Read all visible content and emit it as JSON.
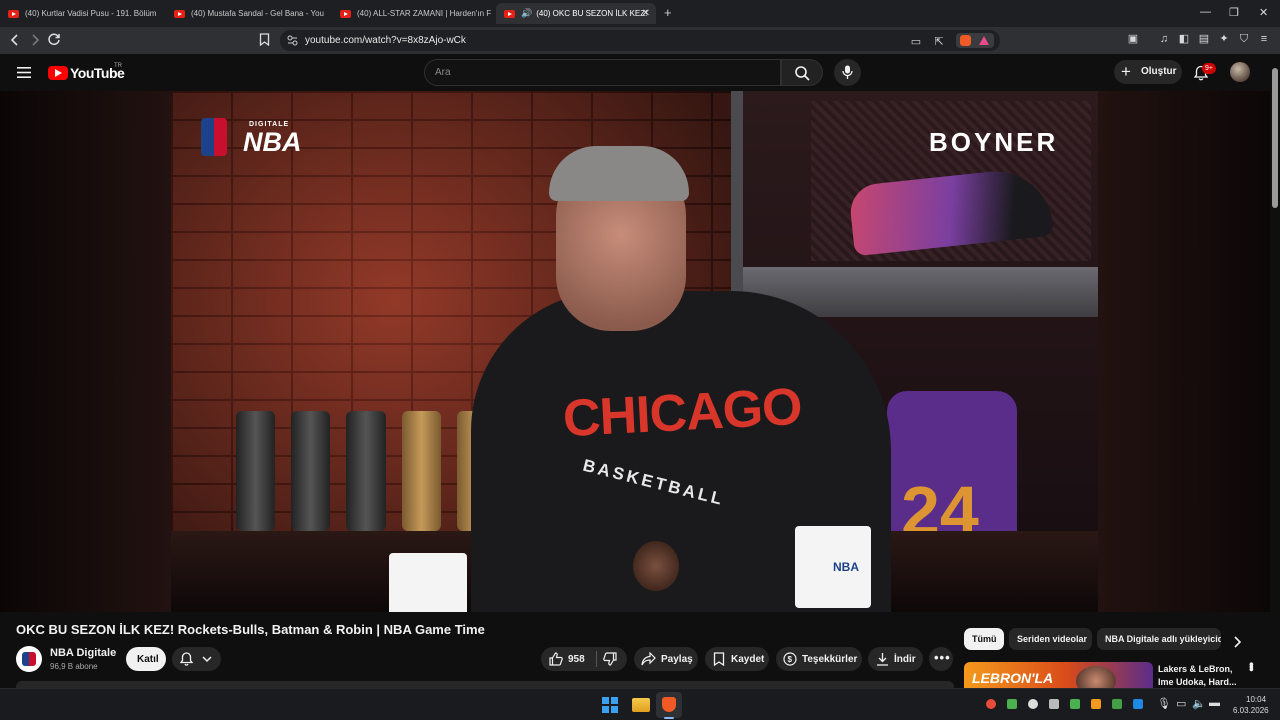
{
  "browser": {
    "tabs": [
      {
        "title": "(40) Kurtlar Vadisi Pusu - 191. Bölüm",
        "active": false
      },
      {
        "title": "(40) Mustafa Sandal - Gel Bana - You",
        "active": false
      },
      {
        "title": "(40) ALL-STAR ZAMANI | Harden'ın F",
        "active": false
      },
      {
        "title": "(40) OKC BU SEZON İLK KEZ!",
        "active": true
      }
    ],
    "url": "youtube.com/watch?v=8x8zAjo-wCk",
    "new_tab": "+",
    "close_tab": "✕"
  },
  "header": {
    "logo_text": "YouTube",
    "logo_region": "TR",
    "search_placeholder": "Ara",
    "create_label": "Oluştur",
    "notif_badge": "9+"
  },
  "video": {
    "watermark": "NBA",
    "watermark_small": "DIGITALE",
    "sponsor": "BOYNER",
    "shirt_text_1": "CHICAGO",
    "shirt_text_2": "BASKETBALL",
    "jersey_number": "24"
  },
  "info": {
    "title": "OKC BU SEZON İLK KEZ! Rockets-Bulls, Batman & Robin | NBA Game Time",
    "channel_name": "NBA Digitale",
    "subscribers": "96,9 B abone",
    "join_label": "Katıl",
    "like_count": "958",
    "share_label": "Paylaş",
    "save_label": "Kaydet",
    "thanks_label": "Teşekkürler",
    "download_label": "İndir"
  },
  "sidebar": {
    "chips": [
      "Tümü",
      "Seriden videolar",
      "NBA Digitale adlı yükleyicid"
    ],
    "rec_title_1": "Lakers & LeBron,",
    "rec_title_2": "Ime Udoka, Hard...",
    "rec_thumb_text": "LEBRON'LA"
  },
  "taskbar": {
    "time": "10:04",
    "date": "6.03.2026"
  },
  "colors": {
    "yt_red": "#ff0000",
    "bg": "#0f0f0f",
    "chip_active": "#f1f1f1"
  }
}
